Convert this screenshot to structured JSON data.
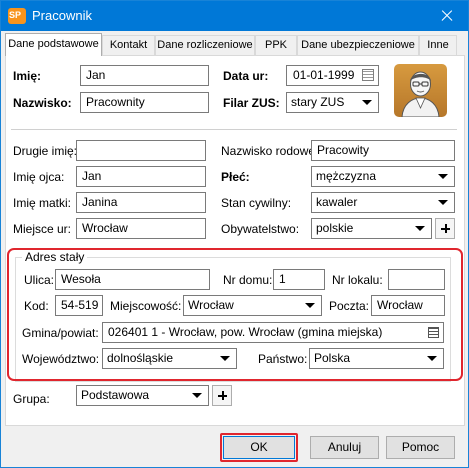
{
  "window": {
    "title": "Pracownik",
    "app_icon_text": "SP"
  },
  "tabs": [
    {
      "label": "Dane podstawowe",
      "active": true
    },
    {
      "label": "Kontakt",
      "active": false
    },
    {
      "label": "Dane rozliczeniowe",
      "active": false
    },
    {
      "label": "PPK",
      "active": false
    },
    {
      "label": "Dane ubezpieczeniowe",
      "active": false
    },
    {
      "label": "Inne",
      "active": false
    }
  ],
  "basic": {
    "imie_label": "Imię:",
    "imie": "Jan",
    "nazwisko_label": "Nazwisko:",
    "nazwisko": "Pracownity",
    "data_ur_label": "Data ur:",
    "data_ur": "01-01-1999",
    "filar_label": "Filar ZUS:",
    "filar": "stary ZUS"
  },
  "personal": {
    "drugie_imie_label": "Drugie imię:",
    "drugie_imie": "",
    "nazwisko_rodowe_label": "Nazwisko rodowe:",
    "nazwisko_rodowe": "Pracowity",
    "imie_ojca_label": "Imię ojca:",
    "imie_ojca": "Jan",
    "plec_label": "Płeć:",
    "plec": "mężczyzna",
    "imie_matki_label": "Imię matki:",
    "imie_matki": "Janina",
    "stan_cywilny_label": "Stan cywilny:",
    "stan_cywilny": "kawaler",
    "miejsce_ur_label": "Miejsce ur:",
    "miejsce_ur": "Wrocław",
    "obywatelstwo_label": "Obywatelstwo:",
    "obywatelstwo": "polskie"
  },
  "address": {
    "group_title": "Adres stały",
    "ulica_label": "Ulica:",
    "ulica": "Wesoła",
    "nr_domu_label": "Nr domu:",
    "nr_domu": "1",
    "nr_lokalu_label": "Nr lokalu:",
    "nr_lokalu": "",
    "kod_label": "Kod:",
    "kod": "54-519",
    "miejscowosc_label": "Miejscowość:",
    "miejscowosc": "Wrocław",
    "poczta_label": "Poczta:",
    "poczta": "Wrocław",
    "gmina_label": "Gmina/powiat:",
    "gmina": "026401 1 - Wrocław, pow. Wrocław (gmina miejska)",
    "wojewodztwo_label": "Województwo:",
    "wojewodztwo": "dolnośląskie",
    "panstwo_label": "Państwo:",
    "panstwo": "Polska"
  },
  "group": {
    "label": "Grupa:",
    "value": "Podstawowa"
  },
  "buttons": {
    "ok": "OK",
    "cancel": "Anuluj",
    "help": "Pomoc"
  },
  "colors": {
    "titlebar": "#0078d7",
    "highlight": "#e0262e"
  }
}
